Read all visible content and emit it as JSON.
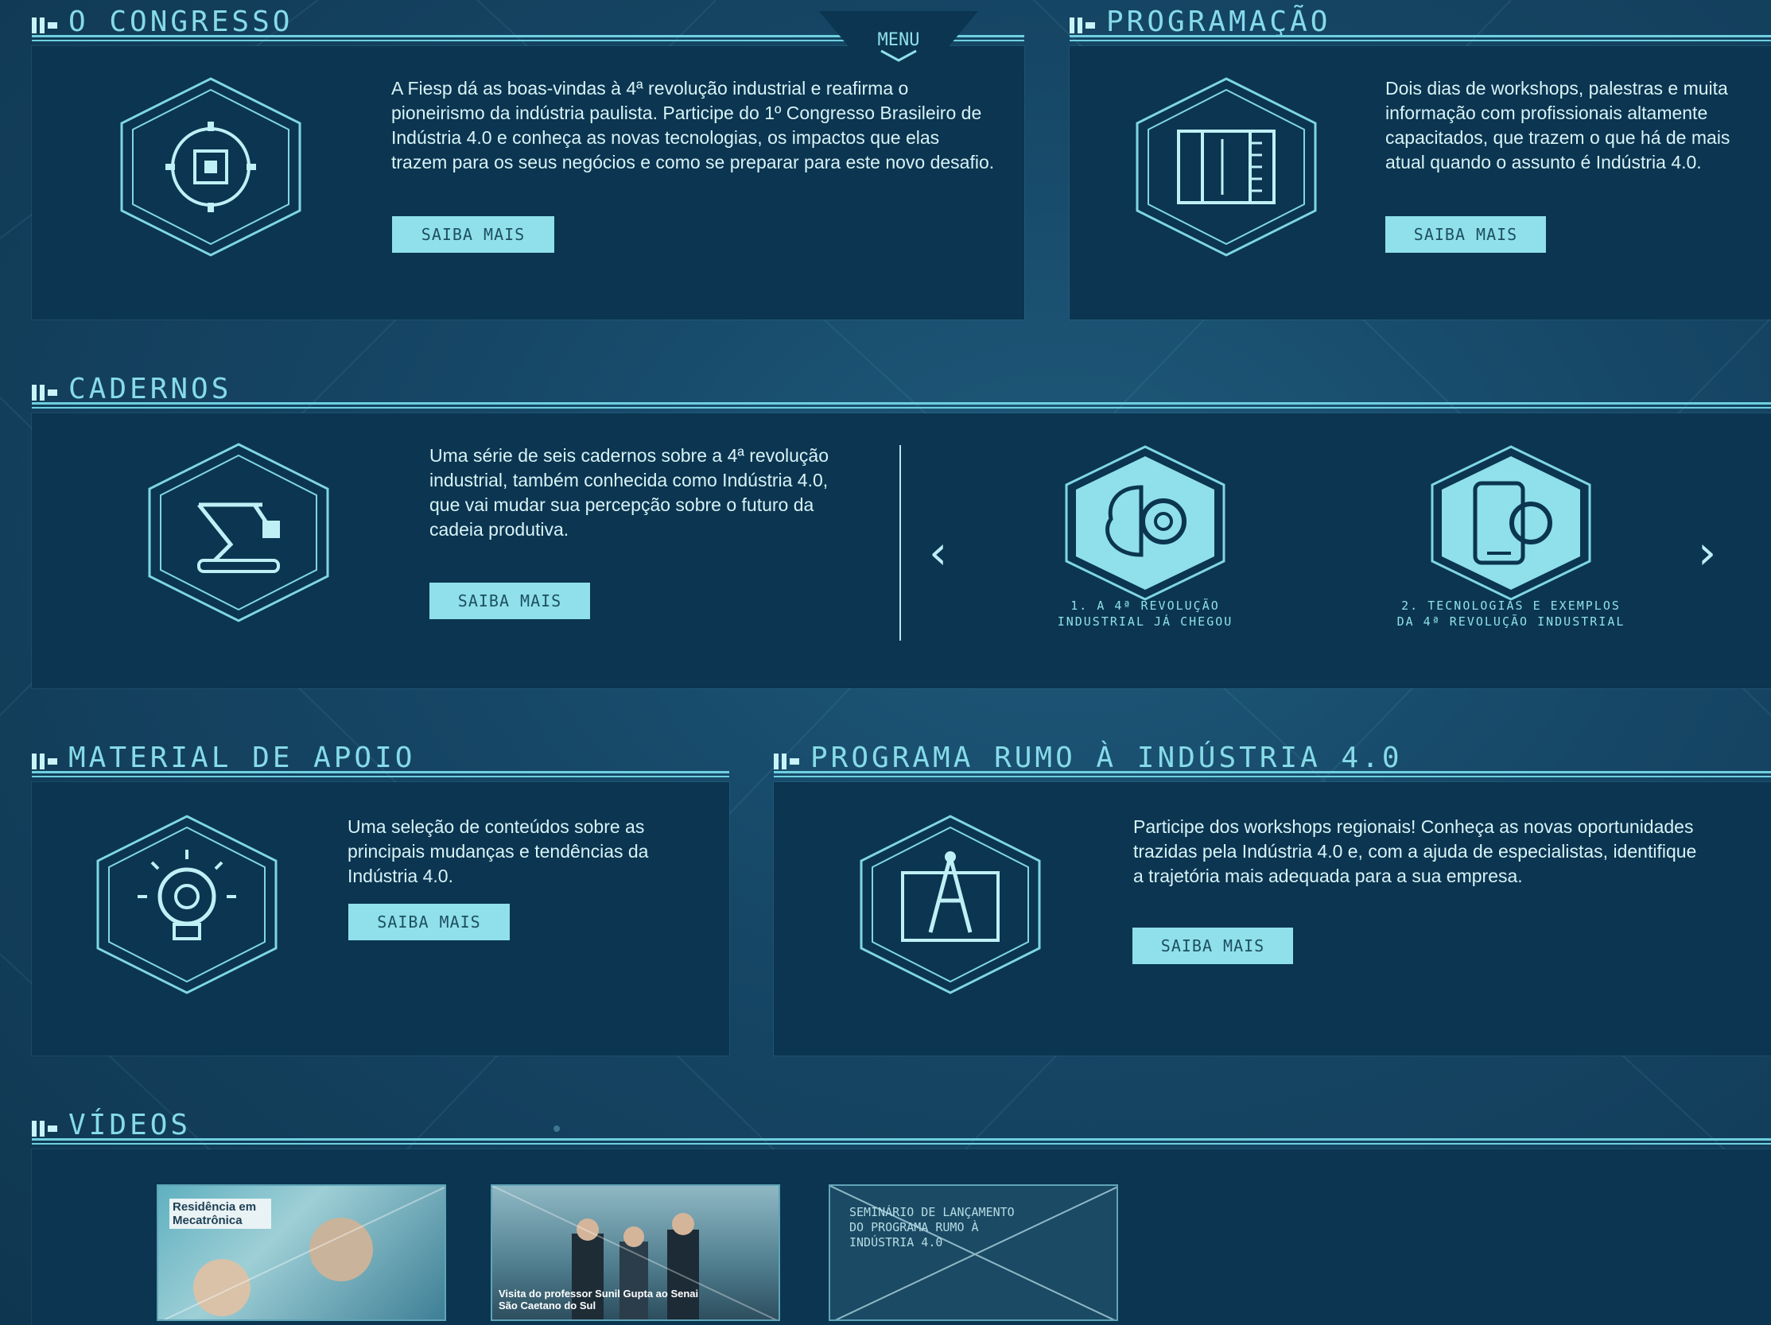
{
  "menu": {
    "label": "MENU"
  },
  "sections": {
    "congresso": {
      "title": "O CONGRESSO",
      "text": "A Fiesp dá as boas-vindas à 4ª revolução industrial e reafirma o pioneirismo da indústria paulista. Participe do 1º Congresso Brasileiro de Indústria 4.0 e conheça as novas tecnologias, os impactos que elas trazem para os seus negócios e como se preparar para este novo desafio.",
      "button": "SAIBA MAIS",
      "icon": "gear-chip-icon"
    },
    "programacao": {
      "title": "PROGRAMAÇÃO",
      "text": "Dois dias de workshops, palestras e muita informação com profissionais altamente capacitados, que trazem o que há de mais atual quando o assunto é Indústria 4.0.",
      "button": "SAIBA MAIS",
      "icon": "blueprint-icon"
    },
    "cadernos": {
      "title": "CADERNOS",
      "text": "Uma série de seis cadernos sobre a 4ª revolução industrial, também conhecida como Indústria 4.0, que vai mudar sua percepção sobre o futuro da cadeia produtiva.",
      "button": "SAIBA MAIS",
      "icon": "robot-arm-icon",
      "carousel": {
        "prev": "‹",
        "next": "›",
        "items": [
          {
            "line1": "1. A 4ª REVOLUÇÃO",
            "line2": "INDUSTRIAL JÁ CHEGOU",
            "icon": "brain-gear-icon"
          },
          {
            "line1": "2. TECNOLOGIAS E EXEMPLOS",
            "line2": "DA 4ª REVOLUÇÃO INDUSTRIAL",
            "icon": "tablet-gear-icon"
          }
        ]
      }
    },
    "material": {
      "title": "MATERIAL DE APOIO",
      "text": "Uma seleção de conteúdos sobre as principais mudanças e tendências da Indústria 4.0.",
      "button": "SAIBA MAIS",
      "icon": "lightbulb-gear-icon"
    },
    "programa": {
      "title": "PROGRAMA RUMO À INDÚSTRIA 4.0",
      "text": "Participe dos workshops regionais! Conheça as novas oportunidades trazidas pela Indústria 4.0 e, com a ajuda de especialistas, identifique a trajetória mais adequada para a sua empresa.",
      "button": "SAIBA MAIS",
      "icon": "compass-map-icon"
    },
    "videos": {
      "title": "VÍDEOS",
      "items": [
        {
          "label": "Residência em Mecatrônica"
        },
        {
          "label": "Visita do professor Sunil Gupta ao Senai São Caetano do Sul"
        },
        {
          "label": "SEMINÁRIO DE LANÇAMENTO DO PROGRAMA RUMO À INDÚSTRIA 4.0"
        }
      ]
    }
  },
  "colors": {
    "accent": "#8fe0ea",
    "panel": "#0b3550",
    "background": "#164766"
  }
}
